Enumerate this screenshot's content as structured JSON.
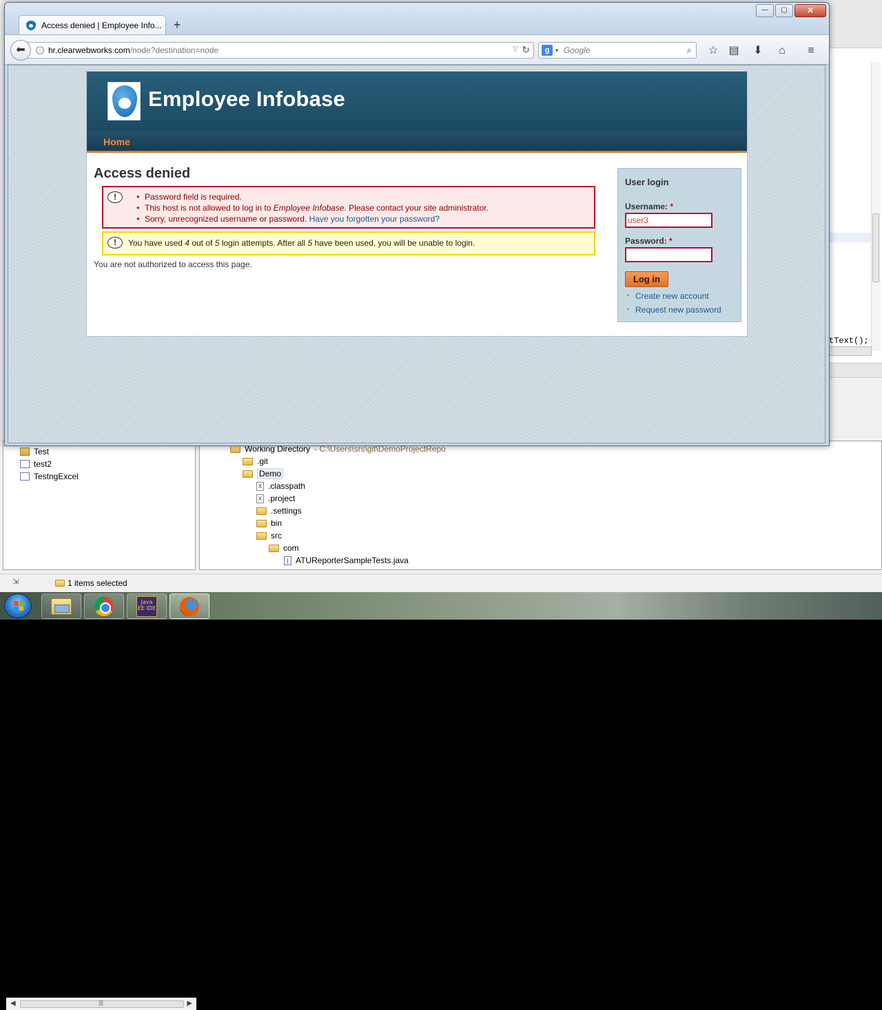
{
  "browser": {
    "tab_title": "Access denied | Employee Info...",
    "new_tab_glyph": "+",
    "url_host": "hr.clearwebworks.com",
    "url_path": "/node?destination=node",
    "search_placeholder": "Google",
    "search_engine_glyph": "g",
    "window_controls": {
      "minimize": "—",
      "maximize": "▢",
      "close": "✕"
    },
    "toolbar_icons": [
      "bookmark-star-icon",
      "reading-list-icon",
      "download-icon",
      "home-icon",
      "menu-icon"
    ]
  },
  "site": {
    "name": "Employee Infobase",
    "nav_home": "Home"
  },
  "main": {
    "title": "Access denied",
    "errors": {
      "e1": "Password field is required.",
      "e2_before": "This host is not allowed to log in to ",
      "e2_site": "Employee Infobase",
      "e2_after": ". Please contact your site administrator.",
      "e3_before": "Sorry, unrecognized username or password. ",
      "e3_link": "Have you forgotten your password?"
    },
    "warning": {
      "part1": "You have used ",
      "used": "4",
      "part2": " out of ",
      "total": "5",
      "part3": " login attempts. After all ",
      "all": "5",
      "part4": " have been used, you will be unable to login."
    },
    "not_authorized": "You are not authorized to access this page."
  },
  "login": {
    "title": "User login",
    "username_label": "Username:",
    "username_value": "user3",
    "password_label": "Password:",
    "required_mark": "*",
    "button": "Log in",
    "create_account": "Create new account",
    "request_password": "Request new password"
  },
  "eclipse": {
    "code_snippet": "tText();",
    "left_items": [
      "Test",
      "test2",
      "TestngExcel"
    ],
    "working_dir_label": "Working Directory",
    "working_dir_path": "- C:\\Users\\srs\\git\\DemoProjectRepo",
    "tree": {
      "git": ".git",
      "demo": "Demo",
      "classpath": ".classpath",
      "project": ".project",
      "settings": ".settings",
      "bin": "bin",
      "src": "src",
      "com": "com",
      "java_file": "ATUReporterSampleTests.java"
    },
    "status": "1 items selected"
  },
  "taskbar": {
    "eclipse_label": "Java EE IDE"
  }
}
